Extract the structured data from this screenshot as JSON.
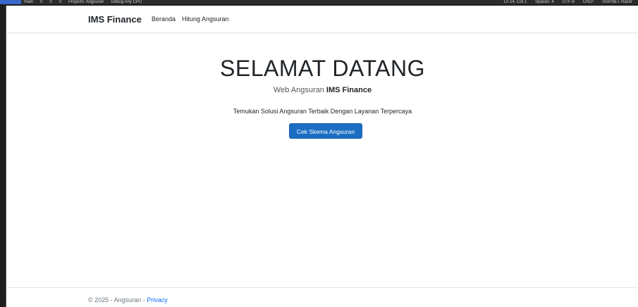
{
  "ide": {
    "left_items": [
      "main",
      "0",
      "0",
      "0",
      "Projects: Angsuran",
      "Debug Any CPU"
    ],
    "right_items": [
      "Ln 14, Col 1",
      "Spaces: 4",
      "UTF-8",
      "CRLF",
      "ASP.NET Razor"
    ]
  },
  "navbar": {
    "brand": "IMS Finance",
    "links": [
      "Beranda",
      "Hitung Angsuran"
    ]
  },
  "hero": {
    "title": "SELAMAT DATANG",
    "subtitle_prefix": "Web Angsuran",
    "subtitle_brand": "IMS Finance",
    "description": "Temukan Solusi Angsuran Terbaik Dengan Layanan Terpercaya",
    "cta_label": "Cek Skema Angsuran"
  },
  "footer": {
    "copyright": "© 2025 - Angsuran -",
    "link_label": "Privacy"
  },
  "colors": {
    "primary_button": "#1b6ec2",
    "link": "#0d6efd"
  }
}
